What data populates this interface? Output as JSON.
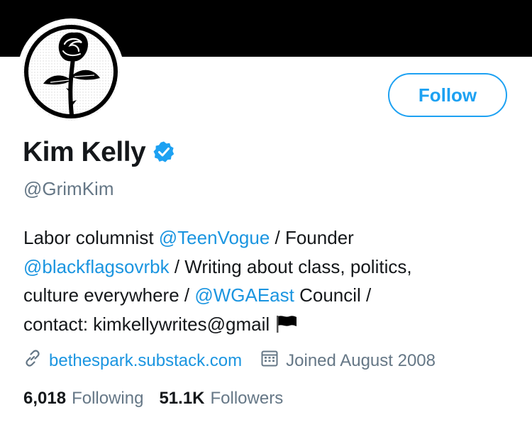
{
  "profile": {
    "name": "Kim Kelly",
    "handle": "@GrimKim",
    "follow_label": "Follow",
    "bio": {
      "line1_a": "Labor columnist ",
      "line1_link": "@TeenVogue",
      "line1_b": " / Founder",
      "line2_link": "@blackflagsovrbk",
      "line2_b": " / Writing about class, politics,",
      "line3_a": "culture everywhere / ",
      "line3_link": "@WGAEast",
      "line3_b": " Council /",
      "line4_a": "contact: kimkellywrites@gmail"
    },
    "website": "bethespark.substack.com",
    "joined": "Joined August 2008",
    "following_count": "6,018",
    "following_label": "Following",
    "followers_count": "51.1K",
    "followers_label": "Followers"
  },
  "icons": {
    "avatar": "black-rose-emblem",
    "verified": "verified-badge-icon",
    "flag": "black-flag-emoji",
    "link": "link-icon",
    "calendar": "calendar-icon"
  },
  "colors": {
    "banner": "#000000",
    "accent": "#1da1f2",
    "link": "#1b95e0",
    "secondary_text": "#657786",
    "primary_text": "#14171a"
  }
}
